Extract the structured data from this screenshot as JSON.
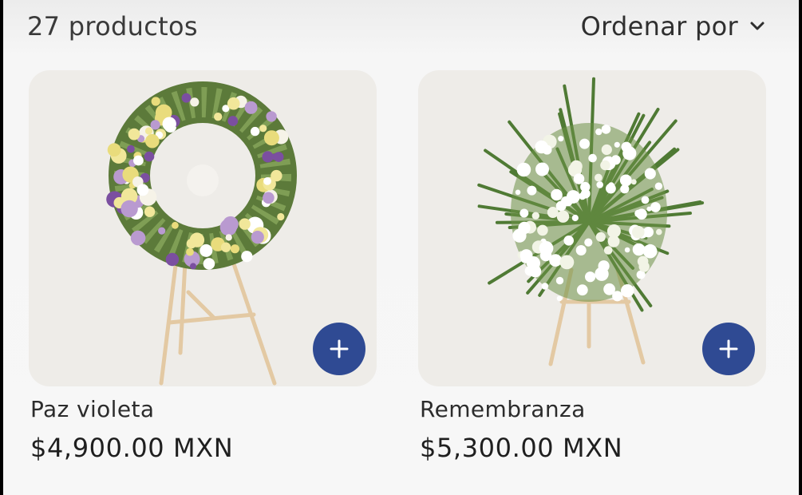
{
  "header": {
    "product_count": "27 productos",
    "sort_label": "Ordenar por"
  },
  "products": [
    {
      "name": "Paz violeta",
      "price": "$4,900.00 MXN",
      "add_icon": "plus-icon"
    },
    {
      "name": "Remembranza",
      "price": "$5,300.00 MXN",
      "add_icon": "plus-icon"
    }
  ],
  "colors": {
    "accent": "#2f4a93",
    "card_bg": "#eeece8",
    "page_bg": "#f7f7f7"
  }
}
